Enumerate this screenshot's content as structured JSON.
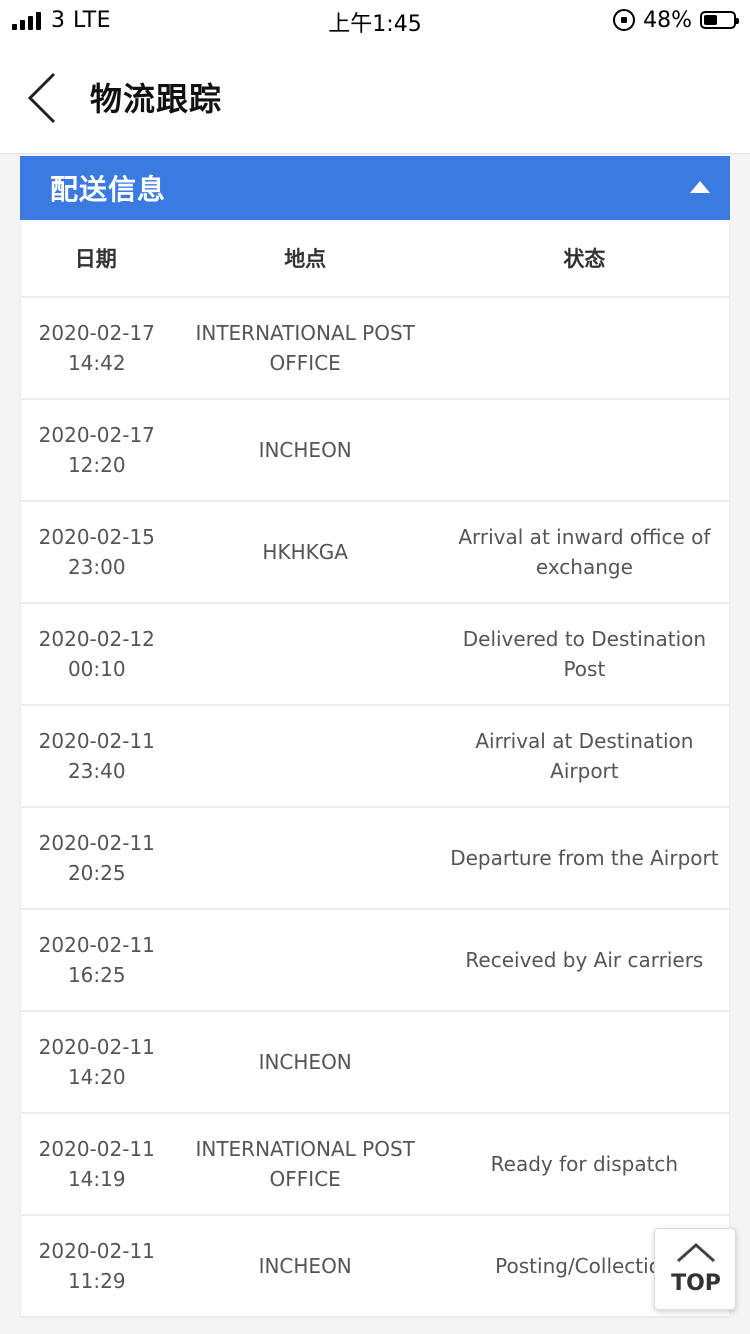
{
  "status_bar": {
    "carrier": "3 LTE",
    "time": "上午1:45",
    "battery_percent": "48%",
    "battery_level": 0.48,
    "icons": [
      "signal-icon",
      "orientation-lock-icon",
      "battery-icon"
    ]
  },
  "nav": {
    "title": "物流跟踪",
    "back_icon": "chevron-left-icon"
  },
  "section": {
    "title": "配送信息",
    "collapse_icon": "triangle-up-icon",
    "accent_color": "#3b7ae0"
  },
  "table": {
    "headers": [
      "日期",
      "地点",
      "状态"
    ],
    "rows": [
      {
        "date": "2020-02-17",
        "time": "14:42",
        "location": "INTERNATIONAL POST OFFICE",
        "status": ""
      },
      {
        "date": "2020-02-17",
        "time": "12:20",
        "location": "INCHEON",
        "status": ""
      },
      {
        "date": "2020-02-15",
        "time": "23:00",
        "location": "HKHKGA",
        "status": "Arrival at inward office of exchange"
      },
      {
        "date": "2020-02-12",
        "time": "00:10",
        "location": "",
        "status": "Delivered to Destination Post"
      },
      {
        "date": "2020-02-11",
        "time": "23:40",
        "location": "",
        "status": "Airrival at Destination Airport"
      },
      {
        "date": "2020-02-11",
        "time": "20:25",
        "location": "",
        "status": "Departure from the Airport"
      },
      {
        "date": "2020-02-11",
        "time": "16:25",
        "location": "",
        "status": "Received by Air carriers"
      },
      {
        "date": "2020-02-11",
        "time": "14:20",
        "location": "INCHEON",
        "status": ""
      },
      {
        "date": "2020-02-11",
        "time": "14:19",
        "location": "INTERNATIONAL POST OFFICE",
        "status": "Ready for dispatch"
      },
      {
        "date": "2020-02-11",
        "time": "11:29",
        "location": "INCHEON",
        "status": "Posting/Collection"
      }
    ]
  },
  "top_button": {
    "label": "TOP",
    "icon": "chevron-up-icon"
  }
}
